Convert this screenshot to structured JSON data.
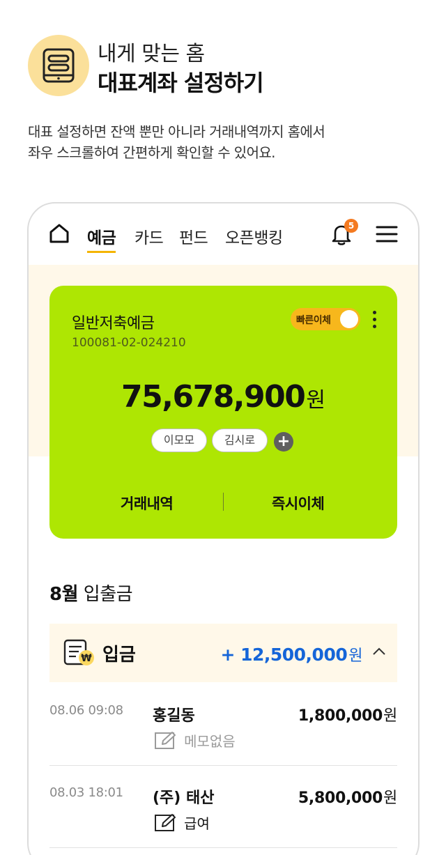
{
  "hero": {
    "subtitle": "내게 맞는 홈",
    "title": "대표계좌 설정하기",
    "icon": "card-list-icon",
    "icon_bg_color": "#fbe09a"
  },
  "description": {
    "line1": "대표 설정하면 잔액 뿐만 아니라 거래내역까지 홈에서",
    "line2": "좌우 스크롤하여 간편하게 확인할 수 있어요."
  },
  "topnav": {
    "tabs": [
      {
        "label": "예금",
        "active": true
      },
      {
        "label": "카드",
        "active": false
      },
      {
        "label": "펀드",
        "active": false
      },
      {
        "label": "오픈뱅킹",
        "active": false
      }
    ],
    "notification_count": "5",
    "accent_color": "#f4b400"
  },
  "account_card": {
    "name": "일반저축예금",
    "number": "100081-02-024210",
    "quick_transfer_label": "빠른이체",
    "quick_transfer_on": true,
    "balance": "75,678,900",
    "balance_unit": "원",
    "tags": [
      "이모모",
      "김시로"
    ],
    "add_tag_symbol": "+",
    "actions": [
      "거래내역",
      "즉시이체"
    ],
    "card_color": "#aee603"
  },
  "monthly": {
    "month": "8월",
    "title": "입출금"
  },
  "deposit": {
    "label": "입금",
    "total": "+ 12,500,000",
    "unit": "원",
    "total_color": "#1565d8",
    "expanded": true
  },
  "transactions": [
    {
      "time": "08.06 09:08",
      "name": "홍길동",
      "amount": "1,800,000",
      "unit": "원",
      "memo": "메모없음",
      "memo_empty": true
    },
    {
      "time": "08.03 18:01",
      "name": "(주) 태산",
      "amount": "5,800,000",
      "unit": "원",
      "memo": "급여",
      "memo_empty": false
    }
  ]
}
